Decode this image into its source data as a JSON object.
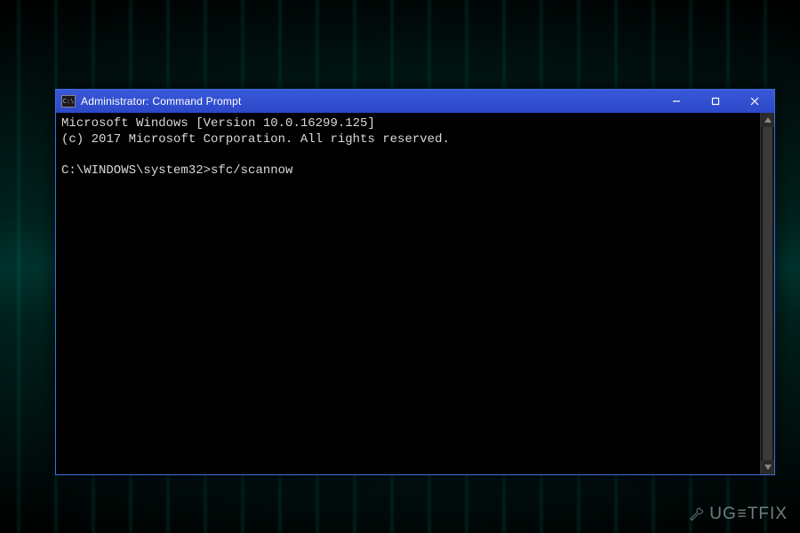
{
  "window": {
    "title": "Administrator: Command Prompt",
    "icon_label": "C:\\"
  },
  "terminal": {
    "line1": "Microsoft Windows [Version 10.0.16299.125]",
    "line2": "(c) 2017 Microsoft Corporation. All rights reserved.",
    "blank": "",
    "prompt": "C:\\WINDOWS\\system32>",
    "command": "sfc/scannow"
  },
  "watermark": {
    "text": "UGETFIX"
  }
}
